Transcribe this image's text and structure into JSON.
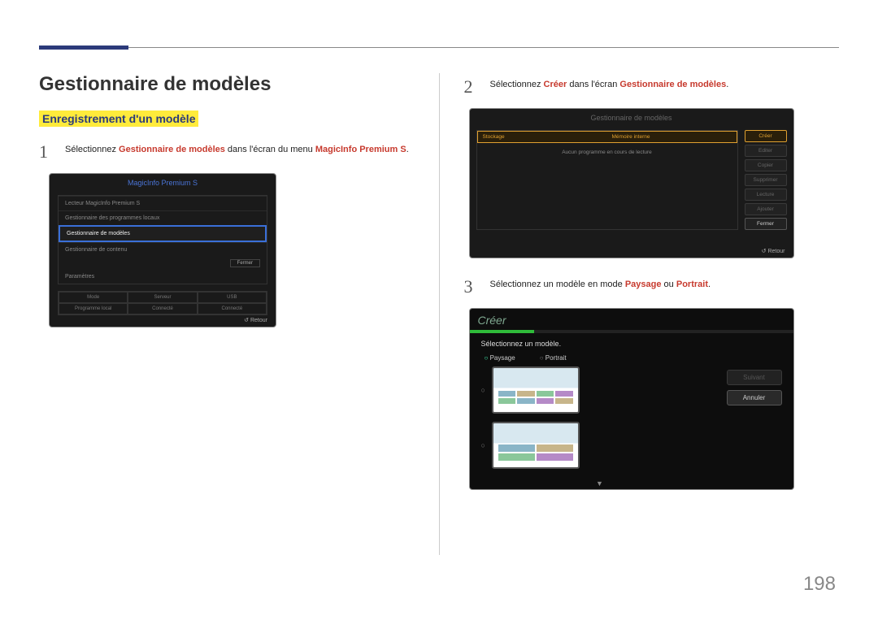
{
  "header": {
    "page_title": "Gestionnaire de modèles",
    "subheading": "Enregistrement d'un modèle"
  },
  "steps": {
    "s1": {
      "num": "1",
      "pre": "Sélectionnez ",
      "hl1": "Gestionnaire de modèles",
      "mid": " dans l'écran du menu ",
      "hl2": "MagicInfo Premium S",
      "post": "."
    },
    "s2": {
      "num": "2",
      "pre": "Sélectionnez ",
      "hl1": "Créer",
      "mid": " dans l'écran ",
      "hl2": "Gestionnaire de modèles",
      "post": "."
    },
    "s3": {
      "num": "3",
      "pre": "Sélectionnez un modèle en mode ",
      "hl1": "Paysage",
      "mid": " ou ",
      "hl2": "Portrait",
      "post": "."
    }
  },
  "screen1": {
    "title": "MagicInfo Premium S",
    "items": [
      "Lecteur MagicInfo Premium S",
      "Gestionnaire des programmes locaux",
      "Gestionnaire de modèles",
      "Gestionnaire de contenu",
      "Paramètres"
    ],
    "close": "Fermer",
    "status": [
      "Mode",
      "Serveur",
      "USB",
      "Programme local",
      "Connecté",
      "Connecté"
    ],
    "retour": "Retour"
  },
  "screen2": {
    "title": "Gestionnaire de modèles",
    "col1": "Stockage",
    "col2": "Mémoire interne",
    "empty": "Aucun programme en cours de lecture",
    "buttons": [
      "Créer",
      "Editer",
      "Copier",
      "Supprimer",
      "Lecture",
      "Ajouter",
      "Fermer"
    ],
    "retour": "Retour"
  },
  "screen3": {
    "title": "Créer",
    "instruction": "Sélectionnez un modèle.",
    "radio1": "Paysage",
    "radio2": "Portrait",
    "btn_next": "Suivant",
    "btn_cancel": "Annuler"
  },
  "page_number": "198"
}
